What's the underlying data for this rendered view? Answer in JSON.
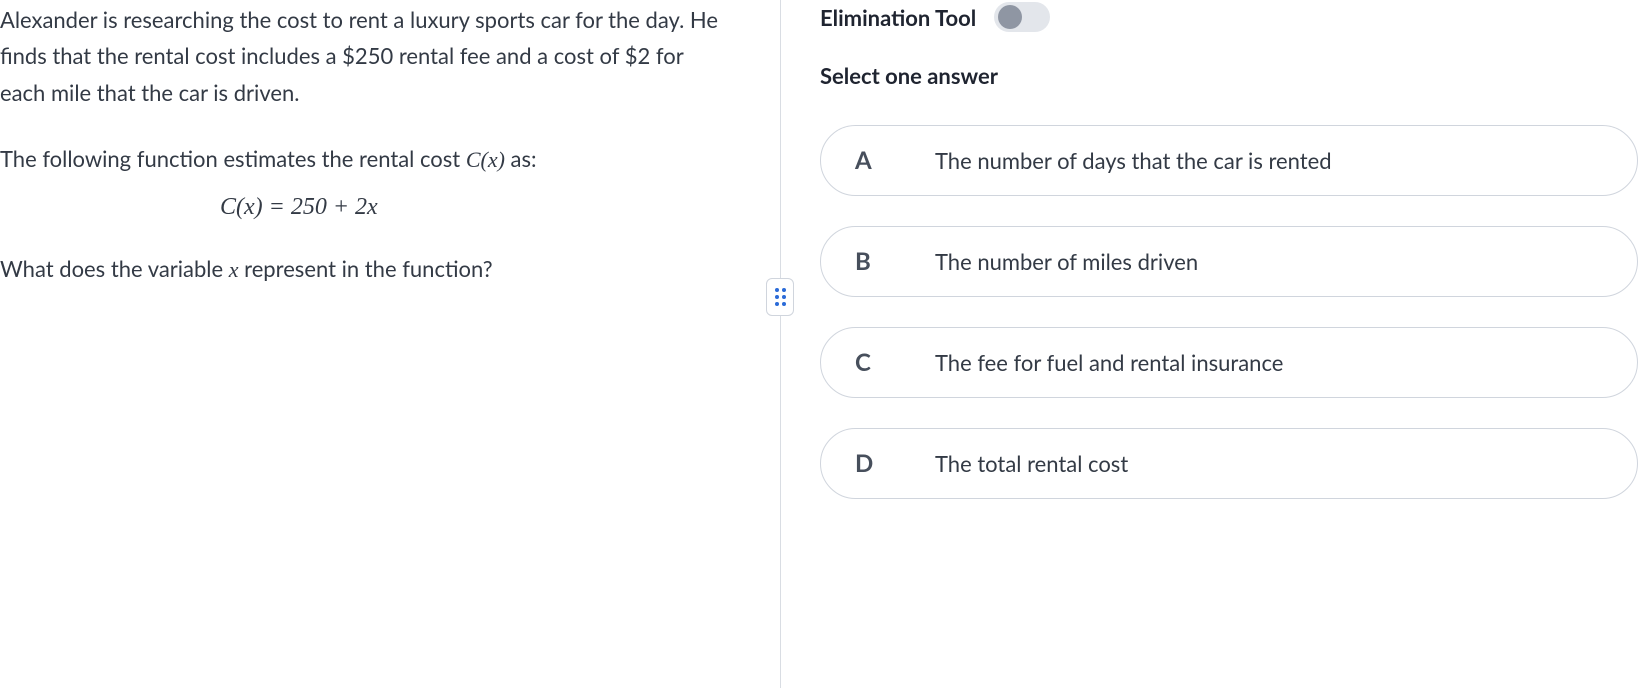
{
  "question": {
    "paragraph1": "Alexander is researching the cost to rent a luxury sports car for the day. He finds that the rental cost includes a $250 rental fee and a cost of $2 for each mile that the car is driven.",
    "paragraph2_pre": "The following function estimates the rental cost ",
    "paragraph2_func": "C(x)",
    "paragraph2_post": " as:",
    "equation": "C(x) = 250 + 2x",
    "prompt_pre": "What does the variable ",
    "prompt_var": "x",
    "prompt_post": " represent in the function?"
  },
  "rightPanel": {
    "eliminationLabel": "Elimination Tool",
    "selectLabel": "Select one answer"
  },
  "options": [
    {
      "letter": "A",
      "text": "The number of days that the car is rented"
    },
    {
      "letter": "B",
      "text": "The number of miles driven"
    },
    {
      "letter": "C",
      "text": "The fee for fuel and rental insurance"
    },
    {
      "letter": "D",
      "text": "The total rental cost"
    }
  ]
}
